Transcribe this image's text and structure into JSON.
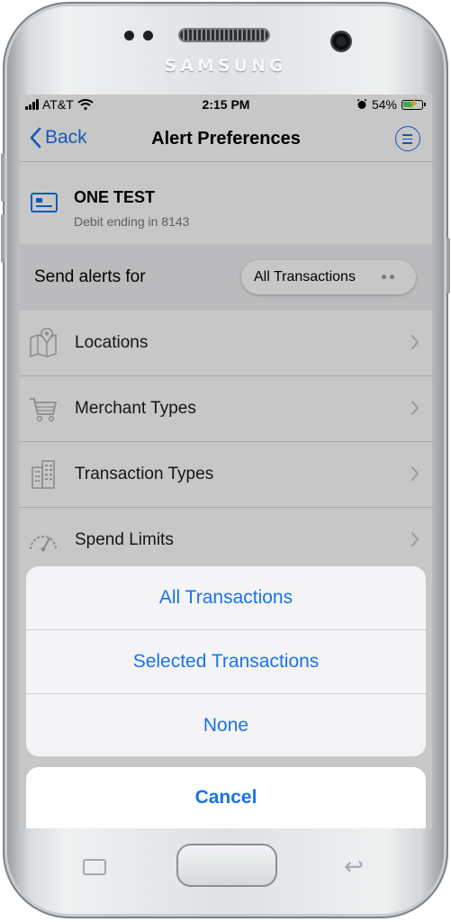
{
  "device": {
    "brand": "SAMSUNG"
  },
  "status_bar": {
    "carrier": "AT&T",
    "time": "2:15 PM",
    "battery_percent": "54%",
    "battery_level": 0.54,
    "battery_color": "#4cd964"
  },
  "nav": {
    "back_label": "Back",
    "title": "Alert Preferences",
    "menu_icon": "menu-icon"
  },
  "card": {
    "name": "ONE TEST",
    "subtitle": "Debit ending in 8143",
    "icon": "credit-card-icon"
  },
  "alerts": {
    "label": "Send alerts for",
    "selected": "All Transactions"
  },
  "list": {
    "items": [
      {
        "label": "Locations",
        "icon": "map-pin-icon"
      },
      {
        "label": "Merchant Types",
        "icon": "shopping-cart-icon"
      },
      {
        "label": "Transaction Types",
        "icon": "building-icon"
      },
      {
        "label": "Spend Limits",
        "icon": "speedometer-icon"
      }
    ]
  },
  "action_sheet": {
    "options": [
      "All Transactions",
      "Selected Transactions",
      "None"
    ],
    "cancel_label": "Cancel"
  },
  "colors": {
    "accent": "#1a73e8",
    "icon_gray": "#b4b4b8"
  }
}
